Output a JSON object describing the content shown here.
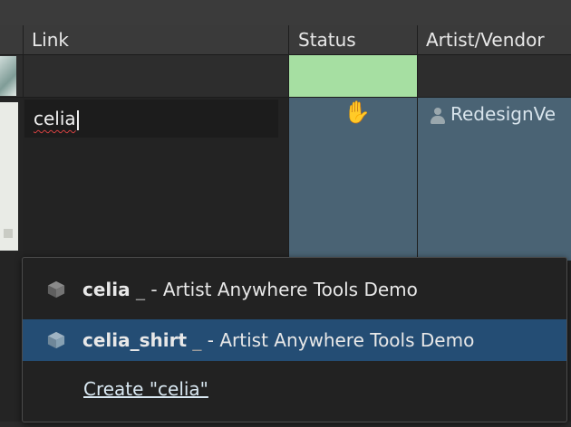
{
  "columns": {
    "link": "Link",
    "status": "Status",
    "artist_vendor": "Artist/Vendor"
  },
  "row": {
    "status_color": "#a6dfa2",
    "link_input_value": "celia",
    "artist_value": "RedesignVe"
  },
  "autocomplete": {
    "items": [
      {
        "name": "celia",
        "sep": "_",
        "project": "- Artist Anywhere Tools Demo",
        "selected": false
      },
      {
        "name": "celia_shirt",
        "sep": "_",
        "project": "- Artist Anywhere Tools Demo",
        "selected": true
      }
    ],
    "create_label": "Create \"celia\""
  },
  "colors": {
    "selection": "#244d74",
    "row_highlight": "#4a6374"
  },
  "icons": [
    "asset-cube-icon",
    "person-icon",
    "hand-cursor-icon"
  ]
}
